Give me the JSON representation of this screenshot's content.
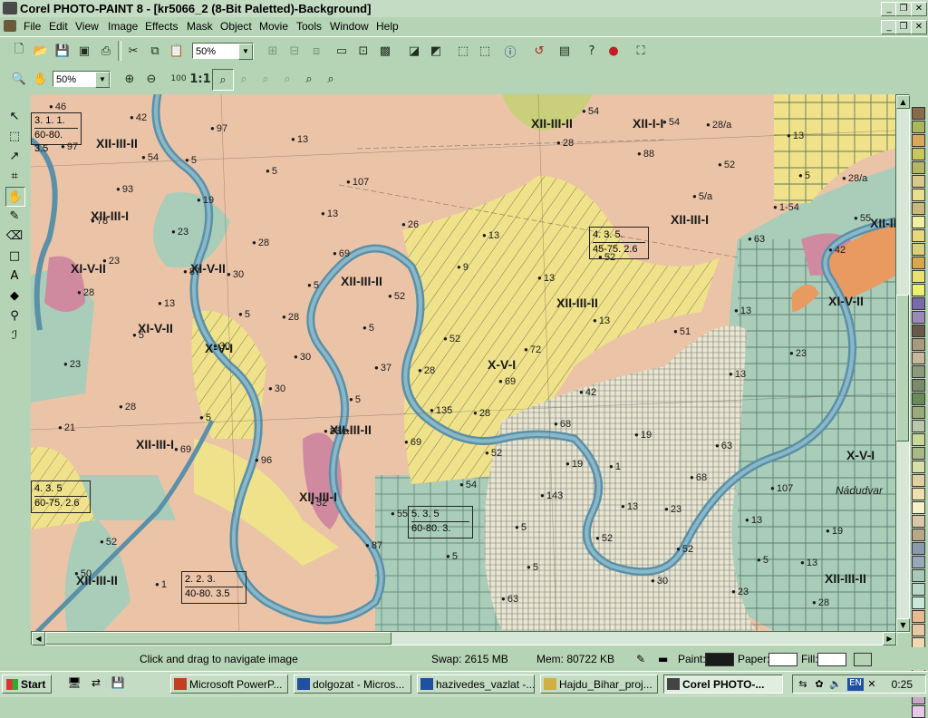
{
  "window": {
    "title": "Corel PHOTO-PAINT 8 - [kr5066_2  (8-Bit Paletted)-Background]",
    "controls": [
      "_",
      "❐",
      "✕"
    ]
  },
  "menu": {
    "items": [
      "File",
      "Edit",
      "View",
      "Image",
      "Effects",
      "Mask",
      "Object",
      "Movie",
      "Tools",
      "Window",
      "Help"
    ]
  },
  "toolbar": {
    "zoom_value": "50%"
  },
  "toolbar2": {
    "zoom_value": "50%",
    "one_to_one": "1:1"
  },
  "map": {
    "unit_labels": [
      "XII-III-II",
      "XII-III-I",
      "XII-III-I",
      "XII-III-II",
      "XII-I-I",
      "XI-V-II",
      "XI-V-II",
      "XI-V-II",
      "X-V-I",
      "XII-III-II",
      "XII-III-II",
      "X-V-I",
      "XII-III-I",
      "XII-III-I",
      "XII-III-II",
      "XII-III-II",
      "XI-V-II",
      "X-V-I",
      "XII-III-II",
      "XII-III-II"
    ],
    "table_boxes": [
      {
        "top": "3.  1.  1.",
        "bottom": "60-80. 3.5"
      },
      {
        "top": "4.  3.  5.",
        "bottom": "45-75. 2.6"
      },
      {
        "top": "4.  3.  5",
        "bottom": "60-75. 2.6"
      },
      {
        "top": "5.  3.  5",
        "bottom": "60-80.  3."
      },
      {
        "top": "2.  2.  3.",
        "bottom": "40-80. 3.5"
      }
    ],
    "points": [
      "46",
      "5",
      "13",
      "9",
      "13",
      "13",
      "21",
      "23",
      "13",
      "42",
      "5",
      "26",
      "13",
      "51",
      "28",
      "1",
      "13",
      "50",
      "97",
      "107",
      "13",
      "28",
      "28",
      "68",
      "68",
      "19",
      "1",
      "13",
      "78",
      "30",
      "5",
      "69",
      "19",
      "107",
      "52",
      "28/a",
      "28/a",
      "23",
      "5",
      "52",
      "42",
      "63",
      "5",
      "30",
      "13",
      "93",
      "28",
      "52",
      "72",
      "85/a",
      "54",
      "52",
      "23",
      "97",
      "19",
      "69",
      "5",
      "30",
      "69",
      "143",
      "52",
      "28",
      "54",
      "63",
      "28",
      "30",
      "5",
      "52",
      "13",
      "5",
      "28",
      "5/a",
      "42",
      "13",
      "30",
      "135",
      "19",
      "87",
      "63",
      "88",
      "1-54",
      "23",
      "5",
      "37",
      "69",
      "52",
      "5",
      "54",
      "52",
      "55",
      "87",
      "23",
      "28",
      "96",
      "55",
      "5",
      "54",
      "5",
      "52",
      "13",
      "23",
      "5"
    ],
    "place_names": [
      "Nádudvar"
    ]
  },
  "palette": {
    "colors": [
      "#8a6a4a",
      "#a8b85a",
      "#d9a85a",
      "#c8c85a",
      "#b5b56a",
      "#d9c88a",
      "#e8e08a",
      "#c8b87a",
      "#f0f0a0",
      "#e8d87a",
      "#d8d07a",
      "#d8a848",
      "#e8e070",
      "#f0f070",
      "#7a6aaa",
      "#9a8aba",
      "#6a5a4a",
      "#a89a7a",
      "#c8b89a",
      "#8a9a7a",
      "#7a8a6a",
      "#6a8a5a",
      "#9aaa7a",
      "#b8c8a8",
      "#c8d898",
      "#a8b888",
      "#d8e0a8",
      "#e0d0a0",
      "#f0e0b0",
      "#f8f0c8",
      "#d8c8a8",
      "#b8a888",
      "#8a9aaa",
      "#98a8b8",
      "#a8c8b8",
      "#b8d8c8",
      "#c8e8d8",
      "#e8b890",
      "#e8c8a0",
      "#f0d8b0",
      "#f8e8c0",
      "#c8c8a8",
      "#a8a8c8",
      "#c8a8c8",
      "#e8c8e8"
    ]
  },
  "statusbar": {
    "hint": "Click and drag to navigate image",
    "swap": "Swap: 2615 MB",
    "mem": "Mem: 80722 KB",
    "paint_label": "Paint:",
    "paper_label": "Paper:",
    "fill_label": "Fill:",
    "paint_color": "#1a1a1a",
    "paper_color": "#ffffff",
    "fill_color": "#ffffff"
  },
  "taskbar": {
    "start": "Start",
    "tasks": [
      "Microsoft PowerP...",
      "dolgozat - Micros...",
      "hazivedes_vazlat -...",
      "Hajdu_Bihar_proj...",
      "Corel PHOTO-..."
    ],
    "language": "EN",
    "clock": "0:25"
  }
}
